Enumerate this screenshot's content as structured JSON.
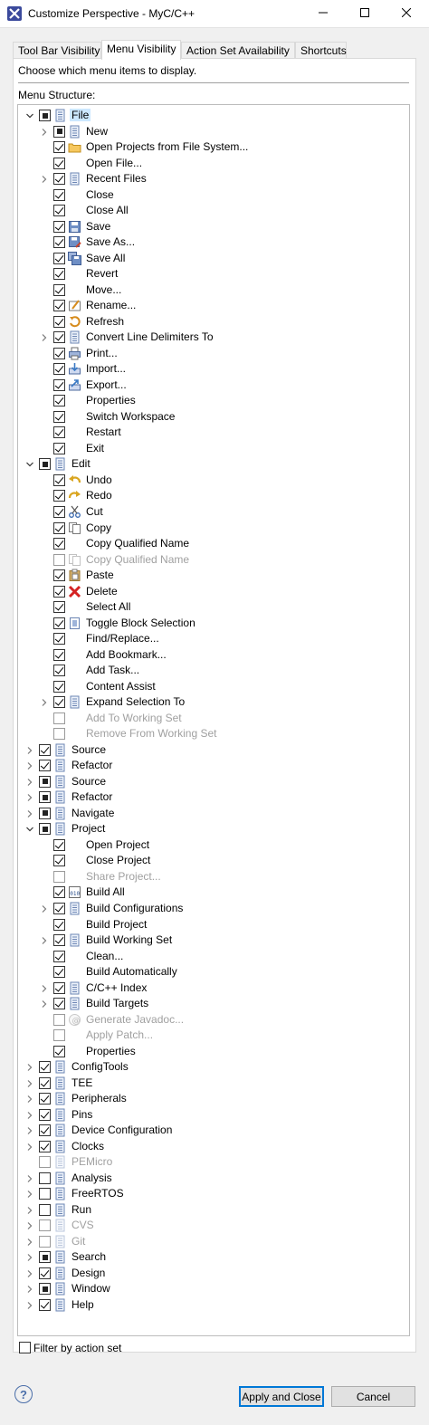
{
  "window": {
    "title": "Customize Perspective - MyC/C++",
    "minimize_icon": "minimize-icon",
    "maximize_icon": "maximize-icon",
    "close_icon": "close-icon"
  },
  "tabs": [
    {
      "label": "Tool Bar Visibility",
      "active": false
    },
    {
      "label": "Menu Visibility",
      "active": true
    },
    {
      "label": "Action Set Availability",
      "active": false
    },
    {
      "label": "Shortcuts",
      "active": false
    }
  ],
  "hint": "Choose which menu items to display.",
  "structure_label": "Menu Structure:",
  "tree": [
    {
      "label": "File",
      "level": 0,
      "exp": "open",
      "check": "partial",
      "icon": "menu-icon",
      "selected": true
    },
    {
      "label": "New",
      "level": 1,
      "exp": "closed",
      "check": "partial",
      "icon": "menu-icon"
    },
    {
      "label": "Open Projects from File System...",
      "level": 1,
      "check": "checked",
      "icon": "folder-icon"
    },
    {
      "label": "Open File...",
      "level": 1,
      "check": "checked"
    },
    {
      "label": "Recent Files",
      "level": 1,
      "exp": "closed",
      "check": "checked",
      "icon": "menu-icon"
    },
    {
      "label": "Close",
      "level": 1,
      "check": "checked"
    },
    {
      "label": "Close All",
      "level": 1,
      "check": "checked"
    },
    {
      "label": "Save",
      "level": 1,
      "check": "checked",
      "icon": "save-icon"
    },
    {
      "label": "Save As...",
      "level": 1,
      "check": "checked",
      "icon": "save-as-icon"
    },
    {
      "label": "Save All",
      "level": 1,
      "check": "checked",
      "icon": "save-all-icon"
    },
    {
      "label": "Revert",
      "level": 1,
      "check": "checked"
    },
    {
      "label": "Move...",
      "level": 1,
      "check": "checked"
    },
    {
      "label": "Rename...",
      "level": 1,
      "check": "checked",
      "icon": "rename-icon"
    },
    {
      "label": "Refresh",
      "level": 1,
      "check": "checked",
      "icon": "refresh-icon"
    },
    {
      "label": "Convert Line Delimiters To",
      "level": 1,
      "exp": "closed",
      "check": "checked",
      "icon": "menu-icon"
    },
    {
      "label": "Print...",
      "level": 1,
      "check": "checked",
      "icon": "print-icon"
    },
    {
      "label": "Import...",
      "level": 1,
      "check": "checked",
      "icon": "import-icon"
    },
    {
      "label": "Export...",
      "level": 1,
      "check": "checked",
      "icon": "export-icon"
    },
    {
      "label": "Properties",
      "level": 1,
      "check": "checked"
    },
    {
      "label": "Switch Workspace",
      "level": 1,
      "check": "checked"
    },
    {
      "label": "Restart",
      "level": 1,
      "check": "checked"
    },
    {
      "label": "Exit",
      "level": 1,
      "check": "checked"
    },
    {
      "label": "Edit",
      "level": 0,
      "exp": "open",
      "check": "partial",
      "icon": "menu-icon"
    },
    {
      "label": "Undo",
      "level": 1,
      "check": "checked",
      "icon": "undo-icon"
    },
    {
      "label": "Redo",
      "level": 1,
      "check": "checked",
      "icon": "redo-icon"
    },
    {
      "label": "Cut",
      "level": 1,
      "check": "checked",
      "icon": "cut-icon"
    },
    {
      "label": "Copy",
      "level": 1,
      "check": "checked",
      "icon": "copy-icon"
    },
    {
      "label": "Copy Qualified Name",
      "level": 1,
      "check": "checked"
    },
    {
      "label": "Copy Qualified Name",
      "level": 1,
      "check": "unchecked",
      "icon": "copy-icon",
      "disabled": true
    },
    {
      "label": "Paste",
      "level": 1,
      "check": "checked",
      "icon": "paste-icon"
    },
    {
      "label": "Delete",
      "level": 1,
      "check": "checked",
      "icon": "delete-icon"
    },
    {
      "label": "Select All",
      "level": 1,
      "check": "checked"
    },
    {
      "label": "Toggle Block Selection",
      "level": 1,
      "check": "checked",
      "icon": "block-selection-icon"
    },
    {
      "label": "Find/Replace...",
      "level": 1,
      "check": "checked"
    },
    {
      "label": "Add Bookmark...",
      "level": 1,
      "check": "checked"
    },
    {
      "label": "Add Task...",
      "level": 1,
      "check": "checked"
    },
    {
      "label": "Content Assist",
      "level": 1,
      "check": "checked"
    },
    {
      "label": "Expand Selection To",
      "level": 1,
      "exp": "closed",
      "check": "checked",
      "icon": "menu-icon"
    },
    {
      "label": "Add To Working Set",
      "level": 1,
      "check": "unchecked",
      "disabled": true
    },
    {
      "label": "Remove From Working Set",
      "level": 1,
      "check": "unchecked",
      "disabled": true
    },
    {
      "label": "Source",
      "level": 0,
      "exp": "closed",
      "check": "checked",
      "icon": "menu-icon"
    },
    {
      "label": "Refactor",
      "level": 0,
      "exp": "closed",
      "check": "checked",
      "icon": "menu-icon"
    },
    {
      "label": "Source",
      "level": 0,
      "exp": "closed",
      "check": "partial",
      "icon": "menu-icon"
    },
    {
      "label": "Refactor",
      "level": 0,
      "exp": "closed",
      "check": "partial",
      "icon": "menu-icon"
    },
    {
      "label": "Navigate",
      "level": 0,
      "exp": "closed",
      "check": "partial",
      "icon": "menu-icon"
    },
    {
      "label": "Project",
      "level": 0,
      "exp": "open",
      "check": "partial",
      "icon": "menu-icon"
    },
    {
      "label": "Open Project",
      "level": 1,
      "check": "checked"
    },
    {
      "label": "Close Project",
      "level": 1,
      "check": "checked"
    },
    {
      "label": "Share Project...",
      "level": 1,
      "check": "unchecked",
      "disabled": true
    },
    {
      "label": "Build All",
      "level": 1,
      "check": "checked",
      "icon": "build-all-icon"
    },
    {
      "label": "Build Configurations",
      "level": 1,
      "exp": "closed",
      "check": "checked",
      "icon": "menu-icon"
    },
    {
      "label": "Build Project",
      "level": 1,
      "check": "checked"
    },
    {
      "label": "Build Working Set",
      "level": 1,
      "exp": "closed",
      "check": "checked",
      "icon": "menu-icon"
    },
    {
      "label": "Clean...",
      "level": 1,
      "check": "checked"
    },
    {
      "label": "Build Automatically",
      "level": 1,
      "check": "checked"
    },
    {
      "label": "C/C++ Index",
      "level": 1,
      "exp": "closed",
      "check": "checked",
      "icon": "menu-icon"
    },
    {
      "label": "Build Targets",
      "level": 1,
      "exp": "closed",
      "check": "checked",
      "icon": "menu-icon"
    },
    {
      "label": "Generate Javadoc...",
      "level": 1,
      "check": "unchecked",
      "icon": "javadoc-icon",
      "disabled": true
    },
    {
      "label": "Apply Patch...",
      "level": 1,
      "check": "unchecked",
      "disabled": true
    },
    {
      "label": "Properties",
      "level": 1,
      "check": "checked"
    },
    {
      "label": "ConfigTools",
      "level": 0,
      "exp": "closed",
      "check": "checked",
      "icon": "menu-icon"
    },
    {
      "label": "TEE",
      "level": 0,
      "exp": "closed",
      "check": "checked",
      "icon": "menu-icon"
    },
    {
      "label": "Peripherals",
      "level": 0,
      "exp": "closed",
      "check": "checked",
      "icon": "menu-icon"
    },
    {
      "label": "Pins",
      "level": 0,
      "exp": "closed",
      "check": "checked",
      "icon": "menu-icon"
    },
    {
      "label": "Device Configuration",
      "level": 0,
      "exp": "closed",
      "check": "checked",
      "icon": "menu-icon"
    },
    {
      "label": "Clocks",
      "level": 0,
      "exp": "closed",
      "check": "checked",
      "icon": "menu-icon"
    },
    {
      "label": "PEMicro",
      "level": 0,
      "check": "unchecked",
      "icon": "menu-icon",
      "disabled": true
    },
    {
      "label": "Analysis",
      "level": 0,
      "exp": "closed",
      "check": "unchecked",
      "icon": "menu-icon"
    },
    {
      "label": "FreeRTOS",
      "level": 0,
      "exp": "closed",
      "check": "unchecked",
      "icon": "menu-icon"
    },
    {
      "label": "Run",
      "level": 0,
      "exp": "closed",
      "check": "unchecked",
      "icon": "menu-icon"
    },
    {
      "label": "CVS",
      "level": 0,
      "exp": "closed",
      "check": "unchecked",
      "icon": "menu-icon",
      "disabled": true
    },
    {
      "label": "Git",
      "level": 0,
      "exp": "closed",
      "check": "unchecked",
      "icon": "menu-icon",
      "disabled": true
    },
    {
      "label": "Search",
      "level": 0,
      "exp": "closed",
      "check": "partial",
      "icon": "menu-icon"
    },
    {
      "label": "Design",
      "level": 0,
      "exp": "closed",
      "check": "checked",
      "icon": "menu-icon"
    },
    {
      "label": "Window",
      "level": 0,
      "exp": "closed",
      "check": "partial",
      "icon": "menu-icon"
    },
    {
      "label": "Help",
      "level": 0,
      "exp": "closed",
      "check": "checked",
      "icon": "menu-icon"
    }
  ],
  "filter": {
    "label": "Filter by action set",
    "checked": false
  },
  "buttons": {
    "help_icon": "help-icon",
    "apply_close": "Apply and Close",
    "cancel": "Cancel"
  }
}
